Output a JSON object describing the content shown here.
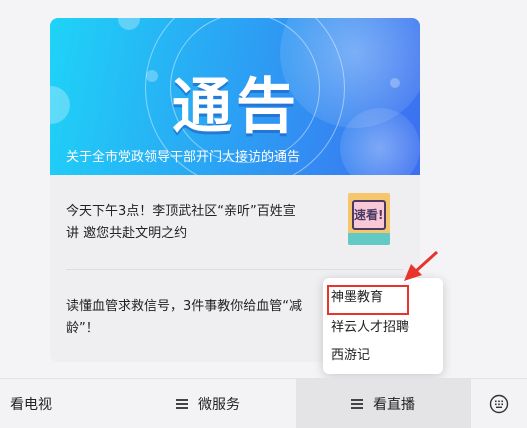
{
  "card": {
    "banner": {
      "big_text": "通告",
      "caption": "关于全市党政领导干部开门大接访的通告"
    },
    "news": [
      {
        "line1": "今天下午3点！李顶武社区“亲听”百姓宣",
        "line2": "讲 邀您共赴文明之约",
        "thumb_text": "速看!"
      },
      {
        "line1": "读懂血管求救信号，3件事教你给血管“减",
        "line2": "龄”！"
      }
    ]
  },
  "popup": {
    "items": [
      "神墨教育",
      "祥云人才招聘",
      "西游记"
    ]
  },
  "bottombar": {
    "tab_tv": "看电视",
    "tab_service": "微服务",
    "tab_live": "看直播",
    "keyboard_icon": "keyboard-icon"
  },
  "colors": {
    "annotation_red": "#e8342c",
    "banner_start": "#1fd3f7",
    "banner_end": "#3d6ff0"
  }
}
